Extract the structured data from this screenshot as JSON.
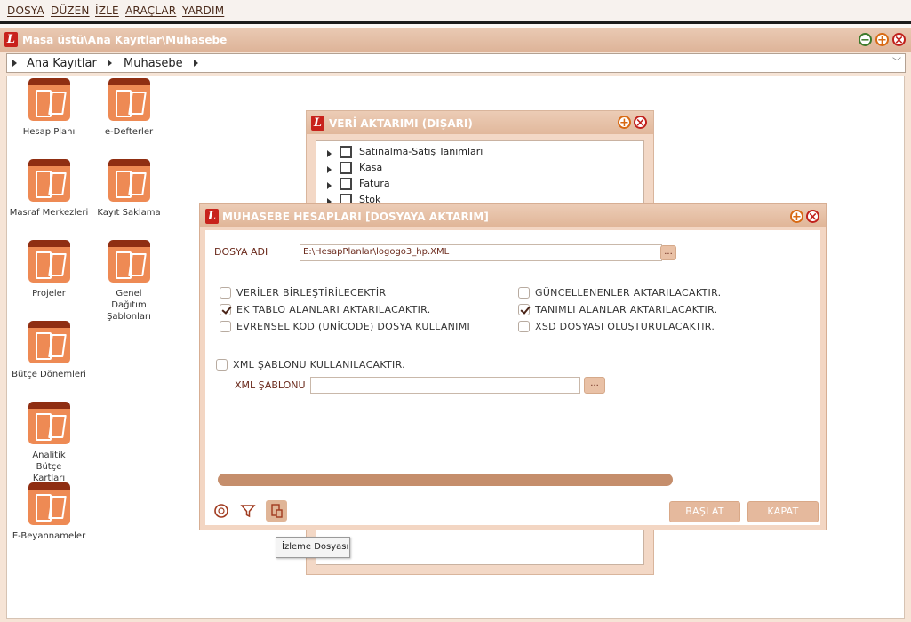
{
  "menubar": {
    "items": [
      "DOSYA",
      "DÜZEN",
      "İZLE",
      "ARAÇLAR",
      "YARDIM"
    ]
  },
  "main_window": {
    "title": "Masa üstü\\Ana Kayıtlar\\Muhasebe",
    "breadcrumb": [
      "Ana Kayıtlar",
      "Muhasebe"
    ],
    "logo_letter": "L"
  },
  "desktop_icons": [
    {
      "label": "Hesap Planı"
    },
    {
      "label": "e-Defterler"
    },
    {
      "label": "Masraf Merkezleri"
    },
    {
      "label": "Kayıt Saklama"
    },
    {
      "label": "Projeler"
    },
    {
      "label": "Genel Dağıtım Şablonları"
    },
    {
      "label": "Bütçe Dönemleri"
    },
    {
      "label": "Analitik Bütçe Kartları"
    },
    {
      "label": "E-Beyannameler"
    }
  ],
  "veri_window": {
    "title": "VERİ AKTARIMI (DIŞARI)",
    "items": [
      "Satınalma-Satış Tanımları",
      "Kasa",
      "Fatura",
      "Stok"
    ]
  },
  "dialog": {
    "title": "MUHASEBE HESAPLARI [DOSYAYA AKTARIM]",
    "file_label": "DOSYA ADI",
    "file_value": "E:\\HesapPlanlar\\logogo3_hp.XML",
    "browse_label": "...",
    "options_left": [
      {
        "label": "VERİLER BİRLEŞTİRİLECEKTİR",
        "checked": false
      },
      {
        "label": "EK TABLO ALANLARI AKTARILACAKTIR.",
        "checked": true
      },
      {
        "label": "EVRENSEL KOD (UNİCODE) DOSYA KULLANIMI",
        "checked": false
      }
    ],
    "options_right": [
      {
        "label": "GÜNCELLENENLER AKTARILACAKTIR.",
        "checked": false
      },
      {
        "label": "TANIMLI ALANLAR AKTARILACAKTIR.",
        "checked": true
      },
      {
        "label": "XSD DOSYASI OLUŞTURULACAKTIR.",
        "checked": false
      }
    ],
    "xml_template_option": {
      "label": "XML ŞABLONU KULLANILACAKTIR.",
      "checked": false
    },
    "xml_template_label": "XML ŞABLONU",
    "xml_template_value": "",
    "start_button": "BAŞLAT",
    "close_button": "KAPAT",
    "footer_icons": [
      "help-circle-icon",
      "filter-icon",
      "database-log-icon"
    ],
    "tooltip": "İzleme Dosyası"
  },
  "colors": {
    "accent": "#e0b597",
    "brand_red": "#c8221b",
    "text_label": "#6b2a1c",
    "progress": "#c58e6c"
  }
}
